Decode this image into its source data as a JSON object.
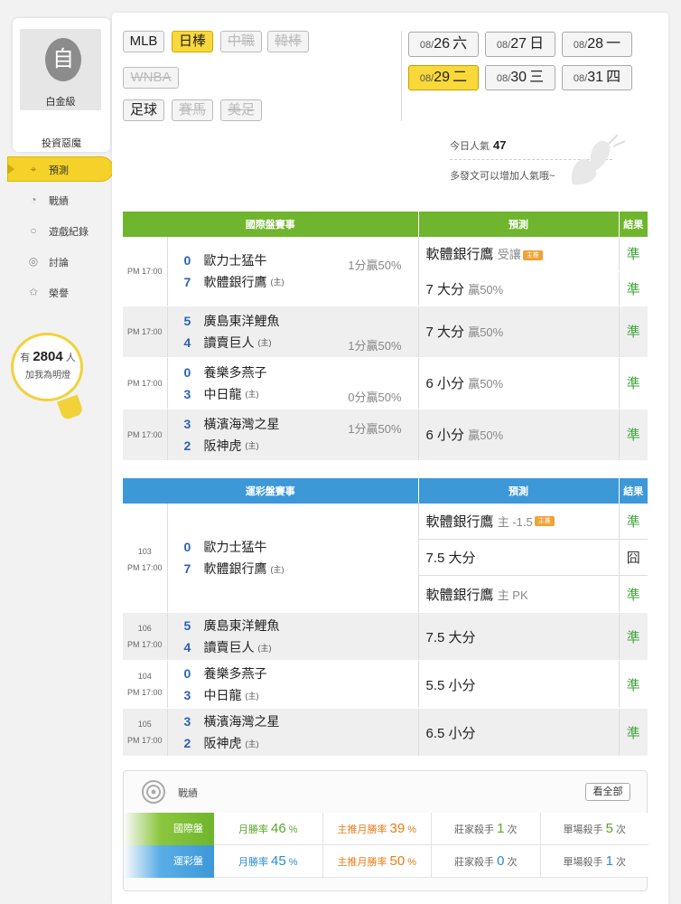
{
  "profile": {
    "avatar_char": "自",
    "level": "白金級",
    "username": "投資惡魔"
  },
  "nav": [
    {
      "label": "預測",
      "icon": "target-icon",
      "active": true
    },
    {
      "label": "戰績",
      "icon": "chat-icon"
    },
    {
      "label": "遊戲紀錄",
      "icon": "circle-icon"
    },
    {
      "label": "討論",
      "icon": "discuss-icon"
    },
    {
      "label": "榮譽",
      "icon": "medal-icon"
    }
  ],
  "bulb": {
    "prefix": "有",
    "count": "2804",
    "suffix": "人",
    "text": "加我為明燈"
  },
  "sports_tabs": [
    "MLB",
    "日棒",
    "中職",
    "韓棒",
    "WNBA",
    "足球",
    "賽馬",
    "美足"
  ],
  "dates": [
    {
      "md": "08/",
      "d": "26",
      "w": "六"
    },
    {
      "md": "08/",
      "d": "27",
      "w": "日"
    },
    {
      "md": "08/",
      "d": "28",
      "w": "一"
    },
    {
      "md": "08/",
      "d": "29",
      "w": "二"
    },
    {
      "md": "08/",
      "d": "30",
      "w": "三"
    },
    {
      "md": "08/",
      "d": "31",
      "w": "四"
    }
  ],
  "popularity": {
    "label": "今日人氣",
    "value": "47",
    "note": "多發文可以增加人氣哦~"
  },
  "intl": {
    "headers": [
      "國際盤賽事",
      "預測",
      "結果"
    ],
    "badge": "主推",
    "games": [
      {
        "time": "PM 17:00",
        "s1": "0",
        "t1": "歐力士猛牛",
        "s2": "7",
        "t2": "軟體銀行鷹",
        "home": "(主)",
        "line": "1分贏50%",
        "p1": "軟體銀行鷹",
        "p1m": "受讓",
        "r1": "準",
        "p2": "7 大分",
        "p2m": "贏50%",
        "r2": "準"
      },
      {
        "time": "PM 17:00",
        "s1": "5",
        "t1": "廣島東洋鯉魚",
        "s2": "4",
        "t2": "讀賣巨人",
        "home": "(主)",
        "line": "1分贏50%",
        "p1": "7 大分",
        "p1m": "贏50%",
        "r1": "準"
      },
      {
        "time": "PM 17:00",
        "s1": "0",
        "t1": "養樂多燕子",
        "s2": "3",
        "t2": "中日龍",
        "home": "(主)",
        "line": "0分贏50%",
        "p1": "6 小分",
        "p1m": "贏50%",
        "r1": "準"
      },
      {
        "time": "PM 17:00",
        "s1": "3",
        "t1": "橫濱海灣之星",
        "s2": "2",
        "t2": "阪神虎",
        "home": "(主)",
        "line": "1分贏50%",
        "p1": "6 小分",
        "p1m": "贏50%",
        "r1": "準"
      }
    ]
  },
  "lottery": {
    "headers": [
      "運彩盤賽事",
      "預測",
      "結果"
    ],
    "badge": "主推",
    "games": [
      {
        "no": "103",
        "time": "PM 17:00",
        "s1": "0",
        "t1": "歐力士猛牛",
        "s2": "7",
        "t2": "軟體銀行鷹",
        "home": "(主)",
        "p1": "軟體銀行鷹",
        "p1m": "主 -1.5",
        "r1": "準",
        "p2": "7.5 大分",
        "r2": "囧",
        "p3": "軟體銀行鷹",
        "p3m": "主 PK",
        "r3": "準"
      },
      {
        "no": "106",
        "time": "PM 17:00",
        "s1": "5",
        "t1": "廣島東洋鯉魚",
        "s2": "4",
        "t2": "讀賣巨人",
        "home": "(主)",
        "p1": "7.5 大分",
        "r1": "準"
      },
      {
        "no": "104",
        "time": "PM 17:00",
        "s1": "0",
        "t1": "養樂多燕子",
        "s2": "3",
        "t2": "中日龍",
        "home": "(主)",
        "p1": "5.5 小分",
        "r1": "準"
      },
      {
        "no": "105",
        "time": "PM 17:00",
        "s1": "3",
        "t1": "橫濱海灣之星",
        "s2": "2",
        "t2": "阪神虎",
        "home": "(主)",
        "p1": "6.5 小分",
        "r1": "準"
      }
    ]
  },
  "stats": {
    "title": "戰績",
    "view_all": "看全部",
    "rows": [
      {
        "label": "國際盤",
        "monthly": "月勝率",
        "monthly_v": "46",
        "pct": "%",
        "main": "主推月勝率",
        "main_v": "39",
        "killer": "莊家殺手",
        "killer_v": "1",
        "times": "次",
        "single": "單場殺手",
        "single_v": "5"
      },
      {
        "label": "運彩盤",
        "monthly": "月勝率",
        "monthly_v": "45",
        "pct": "%",
        "main": "主推月勝率",
        "main_v": "50",
        "killer": "莊家殺手",
        "killer_v": "0",
        "times": "次",
        "single": "單場殺手",
        "single_v": "1"
      }
    ]
  },
  "colors": {
    "green": "#6fb52d",
    "blue": "#3d98d8",
    "yellow": "#f9d83a",
    "win": "#3fa53a"
  }
}
